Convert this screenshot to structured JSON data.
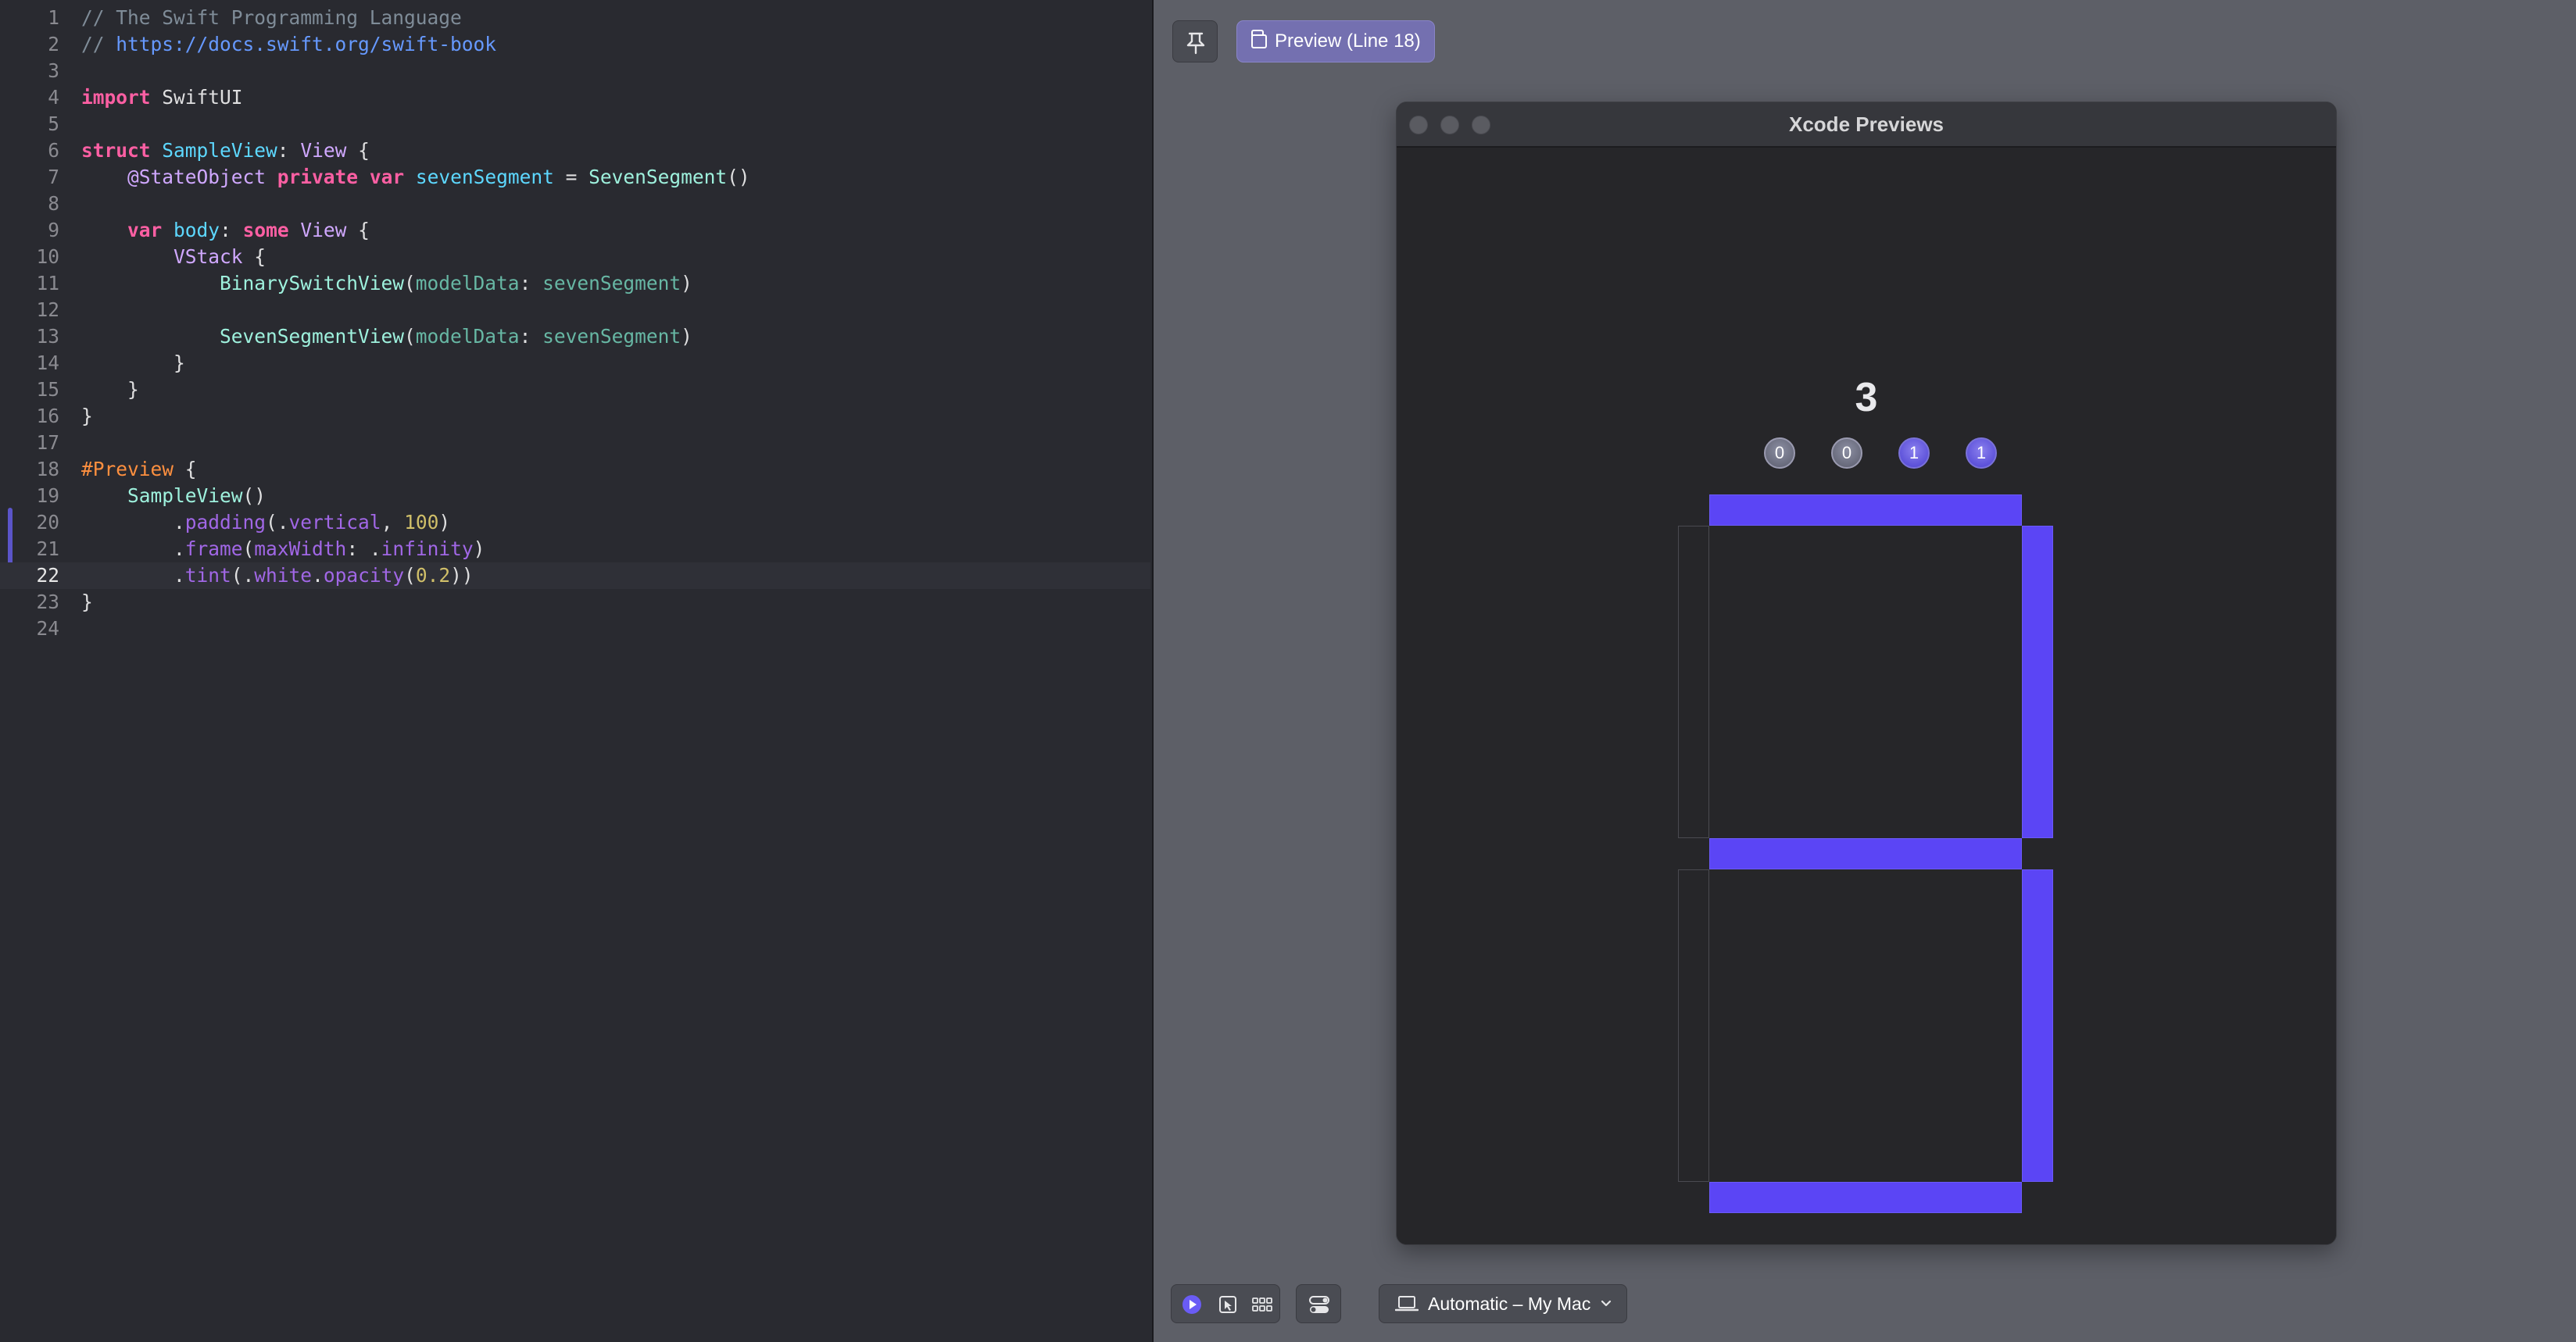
{
  "editor": {
    "lines": [
      {
        "n": "1",
        "tokens": [
          [
            "c-comment",
            "// The Swift Programming Language"
          ]
        ]
      },
      {
        "n": "2",
        "tokens": [
          [
            "c-comment",
            "// "
          ],
          [
            "c-link",
            "https://docs.swift.org/swift-book"
          ]
        ]
      },
      {
        "n": "3",
        "tokens": []
      },
      {
        "n": "4",
        "tokens": [
          [
            "c-kw",
            "import"
          ],
          [
            "c-dim",
            " SwiftUI"
          ]
        ]
      },
      {
        "n": "5",
        "tokens": []
      },
      {
        "n": "6",
        "tokens": [
          [
            "c-kw",
            "struct"
          ],
          [
            "c-dim",
            " "
          ],
          [
            "c-type",
            "SampleView"
          ],
          [
            "c-dim",
            ": "
          ],
          [
            "c-type2",
            "View"
          ],
          [
            "c-dim",
            " {"
          ]
        ]
      },
      {
        "n": "7",
        "tokens": [
          [
            "c-dim",
            "    "
          ],
          [
            "c-type2",
            "@StateObject"
          ],
          [
            "c-dim",
            " "
          ],
          [
            "c-kw",
            "private"
          ],
          [
            "c-dim",
            " "
          ],
          [
            "c-kw",
            "var"
          ],
          [
            "c-dim",
            " "
          ],
          [
            "c-type",
            "sevenSegment"
          ],
          [
            "c-dim",
            " = "
          ],
          [
            "c-cls",
            "SevenSegment"
          ],
          [
            "c-dim",
            "()"
          ]
        ]
      },
      {
        "n": "8",
        "tokens": []
      },
      {
        "n": "9",
        "tokens": [
          [
            "c-dim",
            "    "
          ],
          [
            "c-kw",
            "var"
          ],
          [
            "c-dim",
            " "
          ],
          [
            "c-type",
            "body"
          ],
          [
            "c-dim",
            ": "
          ],
          [
            "c-kw",
            "some"
          ],
          [
            "c-dim",
            " "
          ],
          [
            "c-type2",
            "View"
          ],
          [
            "c-dim",
            " {"
          ]
        ]
      },
      {
        "n": "10",
        "tokens": [
          [
            "c-dim",
            "        "
          ],
          [
            "c-type2",
            "VStack"
          ],
          [
            "c-dim",
            " {"
          ]
        ]
      },
      {
        "n": "11",
        "tokens": [
          [
            "c-dim",
            "            "
          ],
          [
            "c-cls",
            "BinarySwitchView"
          ],
          [
            "c-dim",
            "("
          ],
          [
            "c-mem",
            "modelData"
          ],
          [
            "c-dim",
            ": "
          ],
          [
            "c-mem",
            "sevenSegment"
          ],
          [
            "c-dim",
            ")"
          ]
        ]
      },
      {
        "n": "12",
        "tokens": []
      },
      {
        "n": "13",
        "tokens": [
          [
            "c-dim",
            "            "
          ],
          [
            "c-cls",
            "SevenSegmentView"
          ],
          [
            "c-dim",
            "("
          ],
          [
            "c-mem",
            "modelData"
          ],
          [
            "c-dim",
            ": "
          ],
          [
            "c-mem",
            "sevenSegment"
          ],
          [
            "c-dim",
            ")"
          ]
        ]
      },
      {
        "n": "14",
        "tokens": [
          [
            "c-dim",
            "        }"
          ]
        ]
      },
      {
        "n": "15",
        "tokens": [
          [
            "c-dim",
            "    }"
          ]
        ]
      },
      {
        "n": "16",
        "tokens": [
          [
            "c-dim",
            "}"
          ]
        ]
      },
      {
        "n": "17",
        "tokens": []
      },
      {
        "n": "18",
        "tokens": [
          [
            "c-macro",
            "#Preview"
          ],
          [
            "c-dim",
            " {"
          ]
        ]
      },
      {
        "n": "19",
        "tokens": [
          [
            "c-dim",
            "    "
          ],
          [
            "c-cls",
            "SampleView"
          ],
          [
            "c-dim",
            "()"
          ]
        ]
      },
      {
        "n": "20",
        "tokens": [
          [
            "c-dim",
            "        ."
          ],
          [
            "c-fn",
            "padding"
          ],
          [
            "c-dim",
            "(."
          ],
          [
            "c-fn",
            "vertical"
          ],
          [
            "c-dim",
            ", "
          ],
          [
            "c-num",
            "100"
          ],
          [
            "c-dim",
            ")"
          ]
        ]
      },
      {
        "n": "21",
        "tokens": [
          [
            "c-dim",
            "        ."
          ],
          [
            "c-fn",
            "frame"
          ],
          [
            "c-dim",
            "("
          ],
          [
            "c-fn",
            "maxWidth"
          ],
          [
            "c-dim",
            ": ."
          ],
          [
            "c-fn",
            "infinity"
          ],
          [
            "c-dim",
            ")"
          ]
        ]
      },
      {
        "n": "22",
        "tokens": [
          [
            "c-dim",
            "        ."
          ],
          [
            "c-fn",
            "tint"
          ],
          [
            "c-dim",
            "(."
          ],
          [
            "c-fn",
            "white"
          ],
          [
            "c-dim",
            "."
          ],
          [
            "c-fn",
            "opacity"
          ],
          [
            "c-dim",
            "("
          ],
          [
            "c-num",
            "0.2"
          ],
          [
            "c-dim",
            "))"
          ]
        ]
      },
      {
        "n": "23",
        "tokens": [
          [
            "c-dim",
            "}"
          ]
        ]
      },
      {
        "n": "24",
        "tokens": []
      }
    ],
    "current_line": "22"
  },
  "preview": {
    "chip_label": "Preview (Line 18)",
    "window_title": "Xcode Previews",
    "digit_value": "3",
    "switches": [
      {
        "label": "0",
        "on": false
      },
      {
        "label": "0",
        "on": false
      },
      {
        "label": "1",
        "on": true
      },
      {
        "label": "1",
        "on": true
      }
    ],
    "segments": {
      "a": true,
      "b": true,
      "c": true,
      "d": true,
      "e": false,
      "f": false,
      "g": true
    },
    "device_label": "Automatic – My Mac",
    "colors": {
      "segment_on": "#5b45f5",
      "accent": "#7470b0"
    }
  }
}
